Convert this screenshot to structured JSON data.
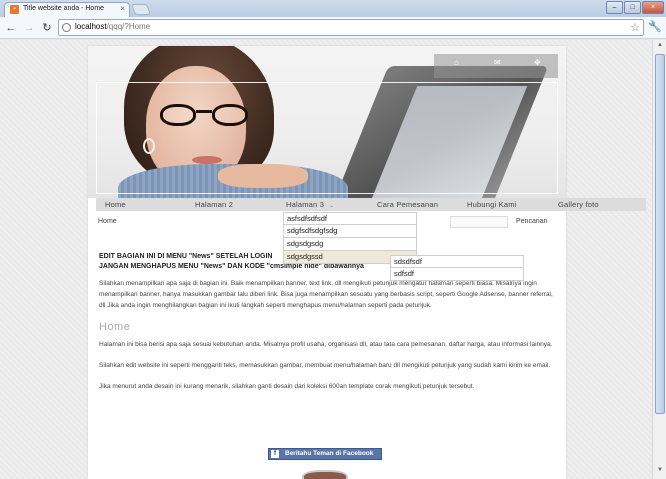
{
  "browser": {
    "tab_title": "Title website anda - Home",
    "tab_favicon": "favicon-icon",
    "url_host": "localhost",
    "url_path": "/qqq/?Home",
    "window_buttons": [
      "minimize",
      "maximize",
      "close"
    ]
  },
  "header": {
    "banner_icons": [
      "home-icon",
      "mail-icon",
      "sitemap-icon"
    ]
  },
  "nav": {
    "items": [
      {
        "label": "Home"
      },
      {
        "label": "Halaman 2"
      },
      {
        "label": "Halaman 3"
      },
      {
        "label": "Cara Pemesanan"
      },
      {
        "label": "Hubungi Kami"
      },
      {
        "label": "Gallery foto"
      }
    ]
  },
  "dropdown": {
    "items": [
      "asfsdfsdfsdf",
      "sdgfsdfsdgfsdg",
      "sdgsdgsdg",
      "sdgsdgssd"
    ],
    "submenu": [
      "sdsdfsdf",
      "sdfsdf"
    ]
  },
  "breadcrumb": "Home",
  "search": {
    "label": "Pencarian",
    "value": ""
  },
  "content": {
    "notice_line1": "EDIT BAGIAN INI DI MENU \"News\" SETELAH LOGIN",
    "notice_line2": "JANGAN MENGHAPUS MENU \"News\" DAN KODE \"cmsimple hide\" dibawahnya",
    "intro": "Silahkan menampilkan apa saja di bagian ini. Baik menampilkan banner, text link, dll mengikuti petunjuk mengatur halaman seperti biasa. Misalnya ingin menampilkan banner, hanya masukkan gambar lalu diberi link. Bisa juga menampilkan sesuatu yang berbasis script, seperti Google Adsense, banner referral, dll Jika anda ingin menghilangkan bagian ini ikuti langkah seperti menghapus menu/halaman seperti pada petunjuk.",
    "heading": "Home",
    "p1": "Halaman ini bisa berisi apa saja sesuai kebutuhan anda. Misalnya profil usaha, organisasi dll, atau tata cara pemesanan, daftar harga, atau informasi lainnya.",
    "p2": "Silahkan edit website ini seperti mengganti teks, memasukkan gambar, membuat menu/halaman baru dll mengikuti petunjuk yang sudah kami kirim ke email.",
    "p3": "Jika menurut anda desain ini kurang menarik, silahkan ganti desain dari koleksi 600an template corak mengikuti petunjuk tersebut."
  },
  "facebook_button": "Beritahu Teman di Facebook"
}
